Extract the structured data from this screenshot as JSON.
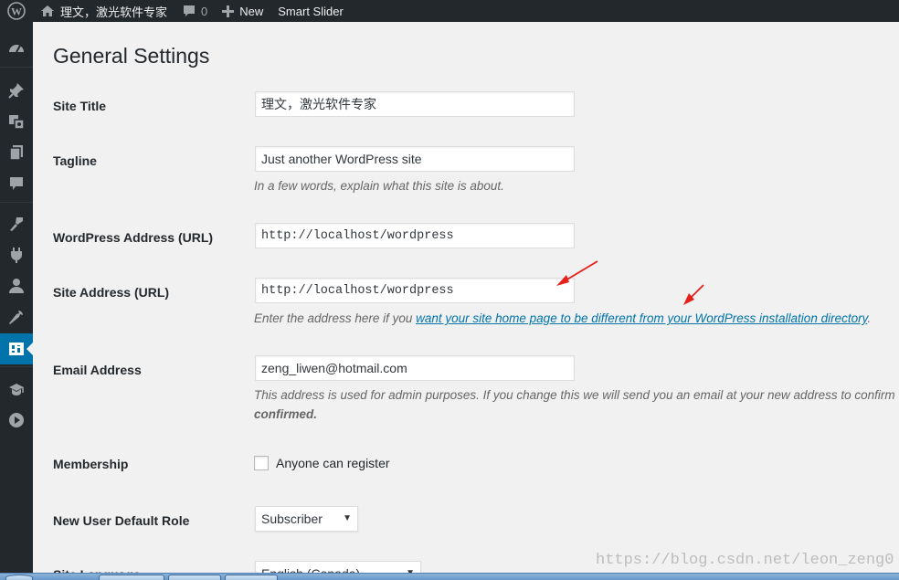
{
  "admin_bar": {
    "site_name": "理文，激光软件专家",
    "comments_count": "0",
    "new_label": "New",
    "plugin_label": "Smart Slider"
  },
  "sidebar": {
    "icons": [
      "dashboard-icon",
      "pin-icon",
      "media-icon",
      "pages-icon",
      "comments-icon",
      "appearance-icon",
      "plugins-icon",
      "users-icon",
      "tools-icon",
      "settings-icon",
      "graduation-cap-icon",
      "video-play-icon"
    ],
    "current": "settings-icon",
    "current_color": "#0073aa"
  },
  "page": {
    "title": "General Settings"
  },
  "fields": {
    "site_title": {
      "label": "Site Title",
      "value": "理文，激光软件专家"
    },
    "tagline": {
      "label": "Tagline",
      "value": "Just another WordPress site",
      "description": "In a few words, explain what this site is about."
    },
    "wp_address": {
      "label": "WordPress Address (URL)",
      "value": "http://localhost/wordpress"
    },
    "site_address": {
      "label": "Site Address (URL)",
      "value": "http://localhost/wordpress",
      "description_prefix": "Enter the address here if you ",
      "description_link": "want your site home page to be different from your WordPress installation directory",
      "description_suffix": "."
    },
    "email": {
      "label": "Email Address",
      "value": "zeng_liwen@hotmail.com",
      "description": "This address is used for admin purposes. If you change this we will send you an email at your new address to confirm",
      "description_bold": "confirmed."
    },
    "membership": {
      "label": "Membership",
      "checkbox_label": "Anyone can register",
      "checked": false
    },
    "default_role": {
      "label": "New User Default Role",
      "value": "Subscriber"
    },
    "site_language": {
      "label": "Site Language",
      "value": "English (Canada)"
    }
  },
  "annotation_color": "#e8201a",
  "watermark": "https://blog.csdn.net/leon_zeng0"
}
